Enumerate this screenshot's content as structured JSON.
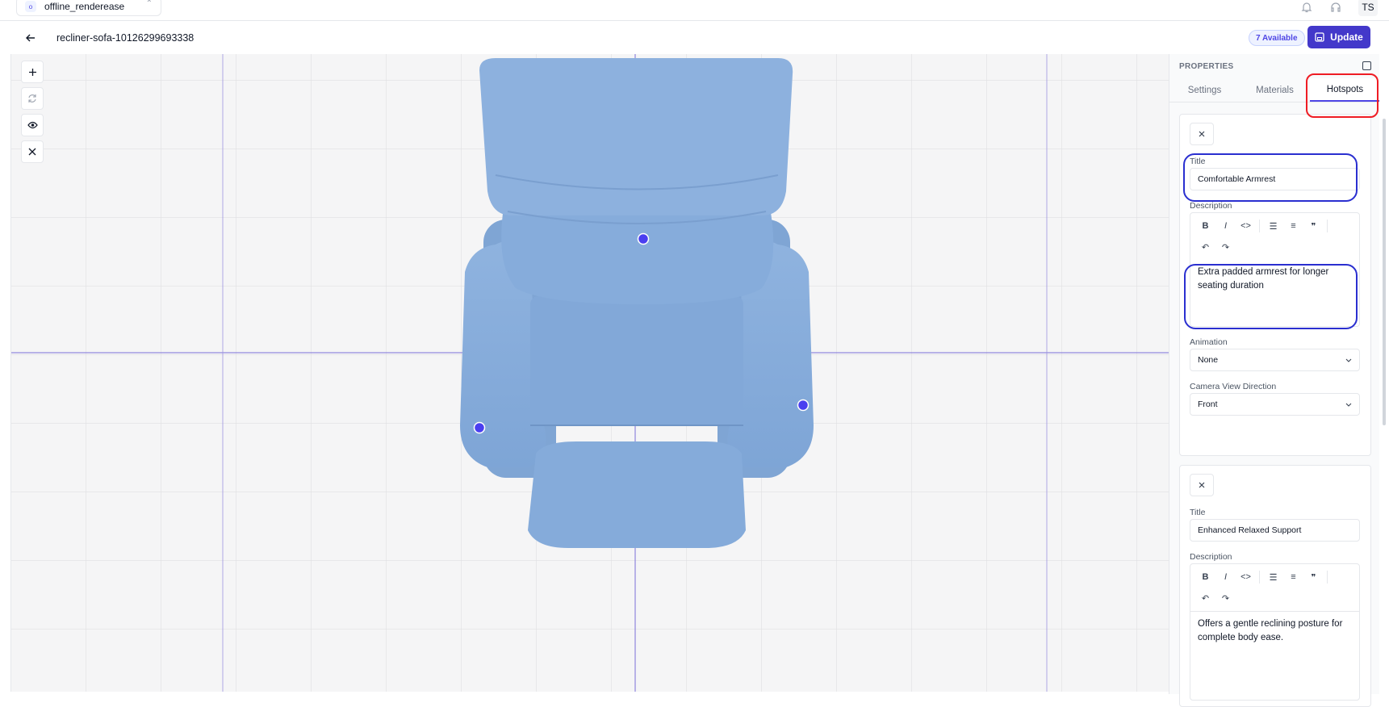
{
  "workspace": {
    "badge": "o",
    "name": "offline_renderease"
  },
  "user": {
    "initials": "TS"
  },
  "header": {
    "title": "recliner-sofa-10126299693338",
    "available": "7 Available",
    "update_label": "Update"
  },
  "viewer": {
    "tools": [
      "plus-icon",
      "refresh-icon",
      "eye-icon",
      "close-icon"
    ],
    "hotspot_count": 3,
    "fabric_color": "#86acdb",
    "hotspot_color": "#4a3ff0"
  },
  "panel": {
    "heading": "PROPERTIES",
    "tabs": [
      "Settings",
      "Materials",
      "Hotspots"
    ],
    "active_tab": "Hotspots",
    "hotspots": [
      {
        "title_label": "Title",
        "title": "Comfortable Armrest",
        "description_label": "Description",
        "description": "Extra padded armrest for longer seating duration",
        "animation_label": "Animation",
        "animation": "None",
        "camera_label": "Camera View Direction",
        "camera": "Front"
      },
      {
        "title_label": "Title",
        "title": "Enhanced Relaxed Support",
        "description_label": "Description",
        "description": "Offers a gentle reclining posture for complete body ease."
      }
    ]
  },
  "colors": {
    "accent": "#4338ca",
    "annotation_red": "#ef1c24",
    "annotation_blue": "#2a2fd0"
  }
}
